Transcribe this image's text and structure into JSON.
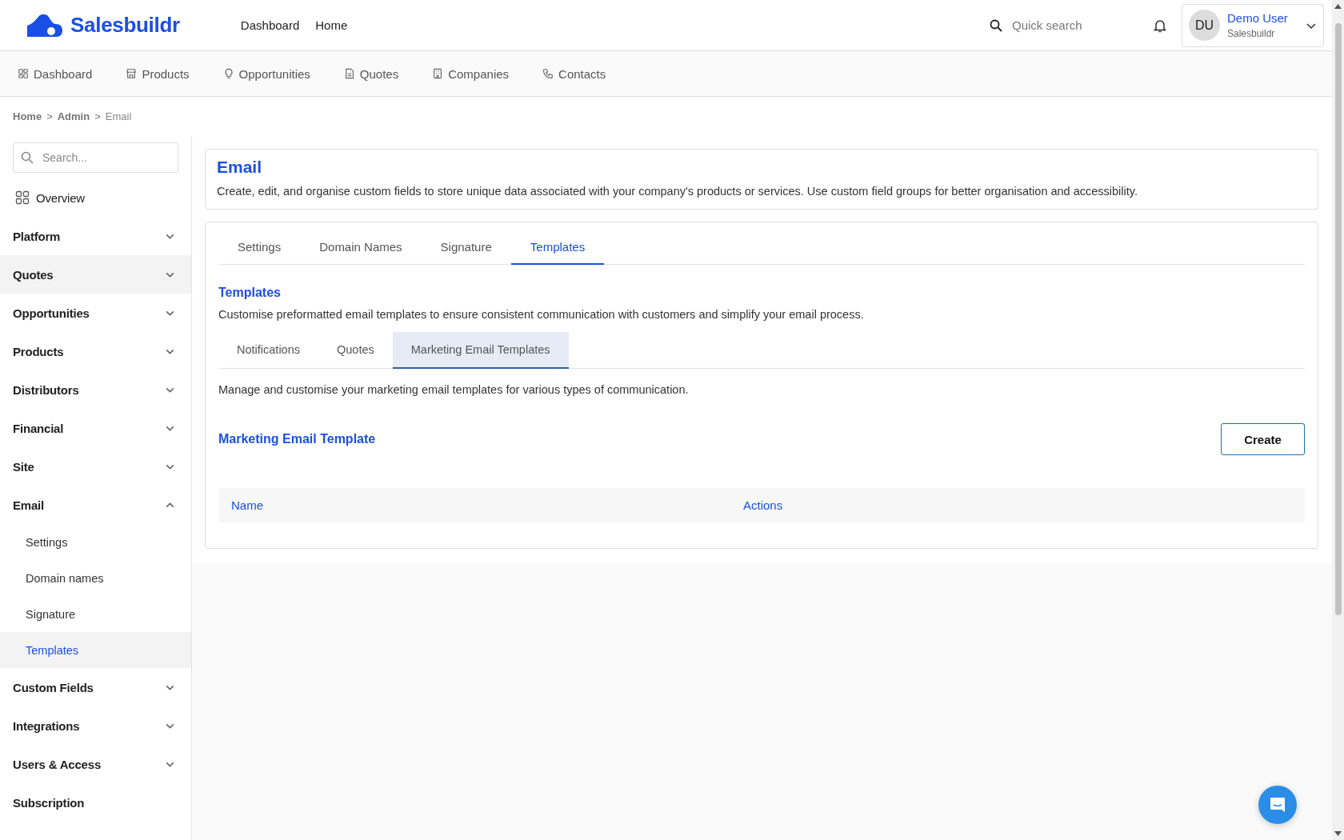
{
  "header": {
    "brand": "Salesbuildr",
    "links": [
      "Dashboard",
      "Home"
    ],
    "search": {
      "placeholder": "Quick search"
    },
    "user": {
      "initials": "DU",
      "name": "Demo User",
      "company": "Salesbuildr"
    }
  },
  "nav": [
    {
      "label": "Dashboard",
      "kind": "grid"
    },
    {
      "label": "Products",
      "kind": "store"
    },
    {
      "label": "Opportunities",
      "kind": "bulb"
    },
    {
      "label": "Quotes",
      "kind": "doc"
    },
    {
      "label": "Companies",
      "kind": "building"
    },
    {
      "label": "Contacts",
      "kind": "phone"
    }
  ],
  "breadcrumb": [
    "Home",
    "Admin",
    "Email"
  ],
  "breadcrumb_separator": ">",
  "sidebar": {
    "search": {
      "placeholder": "Search..."
    },
    "items": [
      {
        "kind": "overview",
        "label": "Overview",
        "hovered": false
      },
      {
        "kind": "group",
        "label": "Platform",
        "expanded": false,
        "hovered": false
      },
      {
        "kind": "group",
        "label": "Quotes",
        "expanded": false,
        "hovered": true
      },
      {
        "kind": "group",
        "label": "Opportunities",
        "expanded": false,
        "hovered": false
      },
      {
        "kind": "group",
        "label": "Products",
        "expanded": false,
        "hovered": false
      },
      {
        "kind": "group",
        "label": "Distributors",
        "expanded": false,
        "hovered": false
      },
      {
        "kind": "group",
        "label": "Financial",
        "expanded": false,
        "hovered": false
      },
      {
        "kind": "group",
        "label": "Site",
        "expanded": false,
        "hovered": false
      },
      {
        "kind": "group",
        "label": "Email",
        "expanded": true,
        "hovered": false,
        "children": [
          {
            "label": "Settings",
            "selected": false
          },
          {
            "label": "Domain names",
            "selected": false
          },
          {
            "label": "Signature",
            "selected": false
          },
          {
            "label": "Templates",
            "selected": true
          }
        ]
      },
      {
        "kind": "group",
        "label": "Custom Fields",
        "expanded": false,
        "hovered": false
      },
      {
        "kind": "group",
        "label": "Integrations",
        "expanded": false,
        "hovered": false
      },
      {
        "kind": "group",
        "label": "Users & Access",
        "expanded": false,
        "hovered": false
      },
      {
        "kind": "link",
        "label": "Subscription",
        "hovered": false
      }
    ]
  },
  "page": {
    "title": "Email",
    "description": "Create, edit, and organise custom fields to store unique data associated with your company's products or services. Use custom field groups for better organisation and accessibility.",
    "tabs": [
      {
        "label": "Settings",
        "selected": false
      },
      {
        "label": "Domain Names",
        "selected": false
      },
      {
        "label": "Signature",
        "selected": false
      },
      {
        "label": "Templates",
        "selected": true
      }
    ],
    "section": {
      "title": "Templates",
      "description": "Customise preformatted email templates to ensure consistent communication with customers and simplify your email process.",
      "tabs": [
        {
          "label": "Notifications",
          "selected": false
        },
        {
          "label": "Quotes",
          "selected": false
        },
        {
          "label": "Marketing Email Templates",
          "selected": true
        }
      ],
      "intro": "Manage and customise your marketing email templates for various types of communication.",
      "list_title": "Marketing Email Template",
      "create_button": "Create",
      "table": {
        "columns": [
          "Name",
          "Actions"
        ]
      }
    }
  }
}
